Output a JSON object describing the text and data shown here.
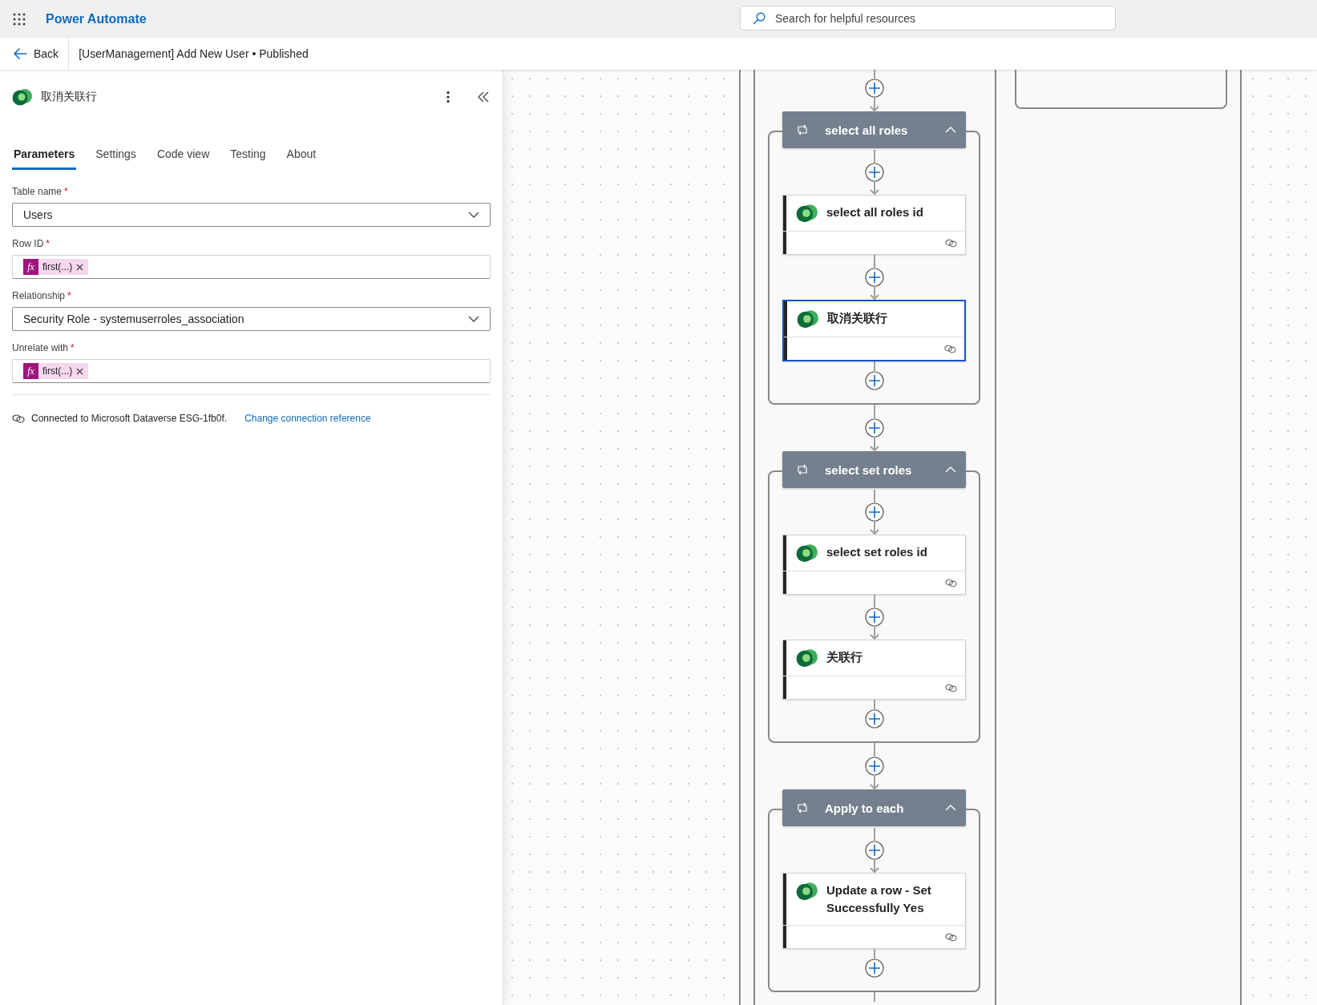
{
  "app": {
    "name": "Power Automate"
  },
  "search": {
    "placeholder": "Search for helpful resources"
  },
  "command_bar": {
    "back": "Back",
    "title": "[UserManagement] Add New User • Published"
  },
  "panel": {
    "title": "取消关联行",
    "tabs": [
      {
        "label": "Parameters",
        "selected": true
      },
      {
        "label": "Settings",
        "selected": false
      },
      {
        "label": "Code view",
        "selected": false
      },
      {
        "label": "Testing",
        "selected": false
      },
      {
        "label": "About",
        "selected": false
      }
    ],
    "fields": [
      {
        "kind": "dropdown",
        "label": "Table name",
        "required_mark": "*",
        "value": "Users"
      },
      {
        "kind": "token",
        "label": "Row ID",
        "required_mark": "*",
        "token_icon": "fx",
        "token": "first(...)"
      },
      {
        "kind": "dropdown",
        "label": "Relationship",
        "required_mark": "*",
        "value": "Security Role - systemuserroles_association"
      },
      {
        "kind": "token",
        "label": "Unrelate with",
        "required_mark": "*",
        "token_icon": "fx",
        "token": "first(...)"
      }
    ],
    "connection": "Connected to Microsoft Dataverse ESG-1fb0f.",
    "change_link": "Change connection reference"
  },
  "flow": {
    "scopes": [
      {
        "title": "select all roles",
        "expanded": true,
        "actions": [
          {
            "title": "select all roles id",
            "selected": false
          },
          {
            "title": "取消关联行",
            "selected": true
          }
        ]
      },
      {
        "title": "select set roles",
        "expanded": true,
        "actions": [
          {
            "title": "select set roles id",
            "selected": false
          },
          {
            "title": "关联行",
            "selected": false
          }
        ]
      },
      {
        "title": "Apply to each",
        "expanded": true,
        "actions": [
          {
            "title": "Update a row - Set Successfully Yes",
            "selected": false
          }
        ]
      }
    ]
  }
}
